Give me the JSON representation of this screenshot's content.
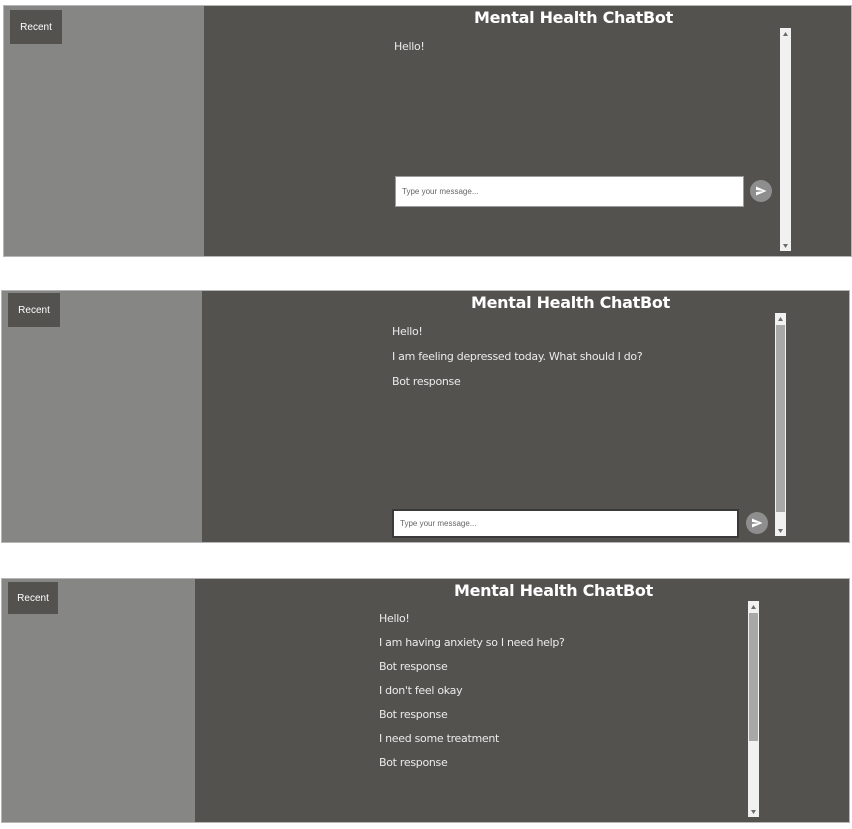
{
  "app": {
    "title": "Mental Health ChatBot",
    "recent_label": "Recent",
    "input_placeholder": "Type your message..."
  },
  "colors": {
    "main_bg": "#53524f",
    "sidebar_bg": "#868784",
    "button_bg": "#53524f",
    "send_btn": "#8e8e8e"
  },
  "icons": {
    "send": "send-arrow-icon",
    "scroll_up": "triangle-up-icon",
    "scroll_down": "triangle-down-icon"
  },
  "screens": [
    {
      "messages": [
        "Hello!"
      ]
    },
    {
      "messages": [
        "Hello!",
        "I am feeling depressed today. What should I do?",
        "Bot response"
      ]
    },
    {
      "messages": [
        "Hello!",
        "I am having anxiety so I need help?",
        "Bot response",
        "I don't feel okay",
        "Bot response",
        "I need some treatment",
        "Bot response"
      ]
    }
  ]
}
